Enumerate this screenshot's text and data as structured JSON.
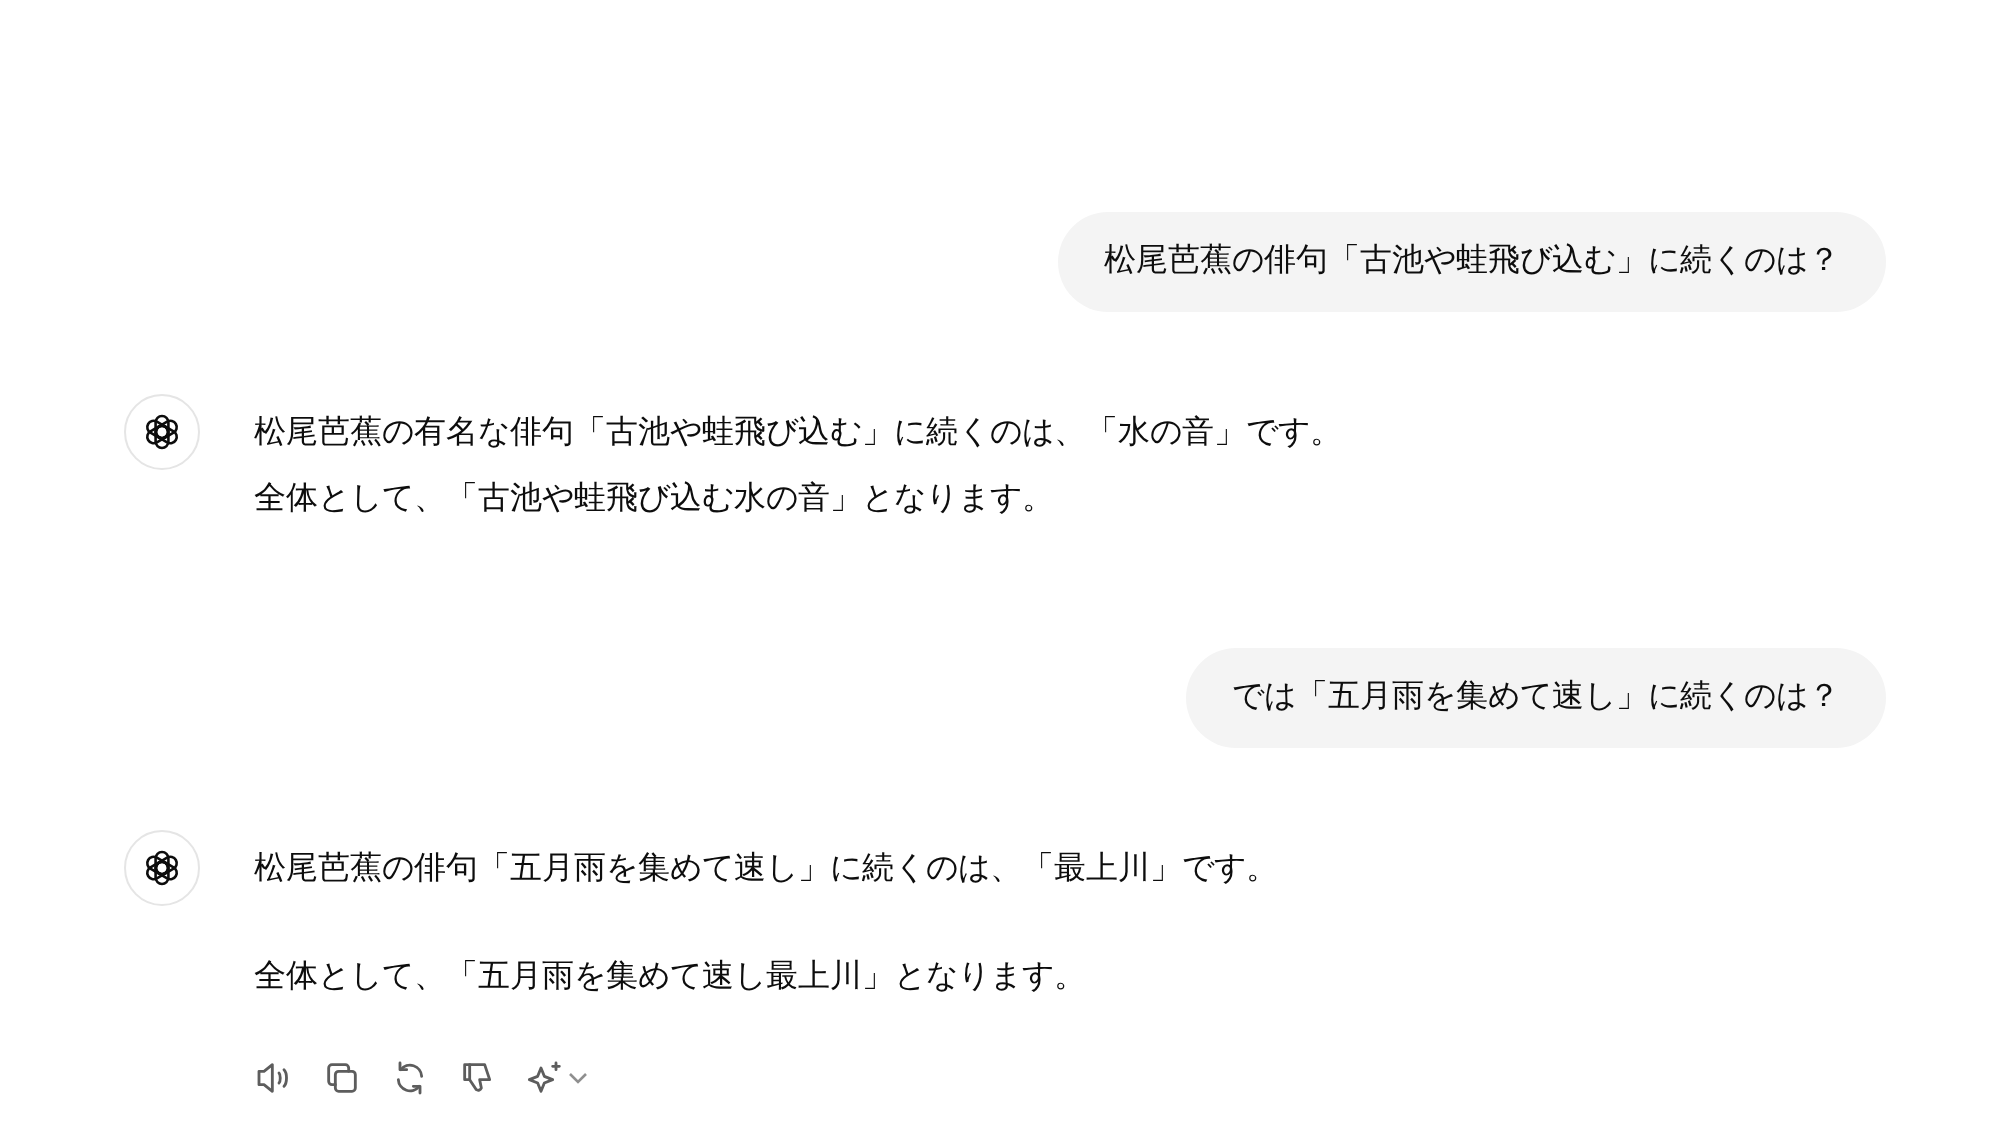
{
  "messages": [
    {
      "kind": "user",
      "text": "松尾芭蕉の俳句「古池や蛙飛び込む」に続くのは？"
    },
    {
      "kind": "assistant",
      "show_actions": false,
      "paragraphs": [
        [
          "松尾芭蕉の有名な俳句「古池や蛙飛び込む」に続くのは、「水の音」です。",
          "全体として、「古池や蛙飛び込む水の音」となります。"
        ]
      ]
    },
    {
      "kind": "user",
      "text": "では「五月雨を集めて速し」に続くのは？"
    },
    {
      "kind": "assistant",
      "show_actions": true,
      "paragraphs": [
        [
          "松尾芭蕉の俳句「五月雨を集めて速し」に続くのは、「最上川」です。"
        ],
        [
          "全体として、「五月雨を集めて速し最上川」となります。"
        ]
      ]
    }
  ]
}
